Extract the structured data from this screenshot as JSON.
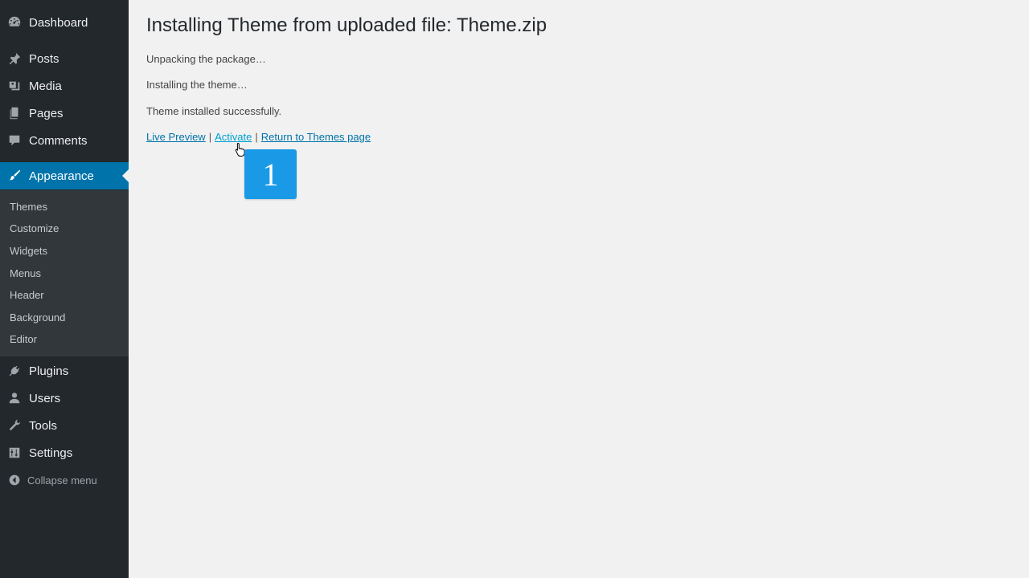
{
  "sidebar": {
    "top_items": [
      {
        "label": "Dashboard",
        "icon": "dashboard-icon"
      },
      {
        "label": "Posts",
        "icon": "pin-icon"
      },
      {
        "label": "Media",
        "icon": "media-icon"
      },
      {
        "label": "Pages",
        "icon": "pages-icon"
      },
      {
        "label": "Comments",
        "icon": "comment-icon"
      }
    ],
    "active_item": {
      "label": "Appearance",
      "icon": "brush-icon"
    },
    "submenu": [
      "Themes",
      "Customize",
      "Widgets",
      "Menus",
      "Header",
      "Background",
      "Editor"
    ],
    "bottom_items": [
      {
        "label": "Plugins",
        "icon": "plug-icon"
      },
      {
        "label": "Users",
        "icon": "user-icon"
      },
      {
        "label": "Tools",
        "icon": "wrench-icon"
      },
      {
        "label": "Settings",
        "icon": "sliders-icon"
      }
    ],
    "collapse_label": "Collapse menu"
  },
  "main": {
    "title": "Installing Theme from uploaded file:  Theme.zip",
    "messages": [
      "Unpacking the package…",
      "Installing the theme…",
      "Theme installed successfully."
    ],
    "actions": {
      "live_preview": "Live Preview",
      "separator": "|",
      "activate": "Activate",
      "return": "Return to Themes page"
    }
  },
  "overlay": {
    "step_number": "1"
  },
  "colors": {
    "sidebar_bg": "#23282d",
    "submenu_bg": "#32373c",
    "accent": "#0073aa",
    "badge": "#1a9ae6",
    "page_bg": "#f1f1f1"
  }
}
